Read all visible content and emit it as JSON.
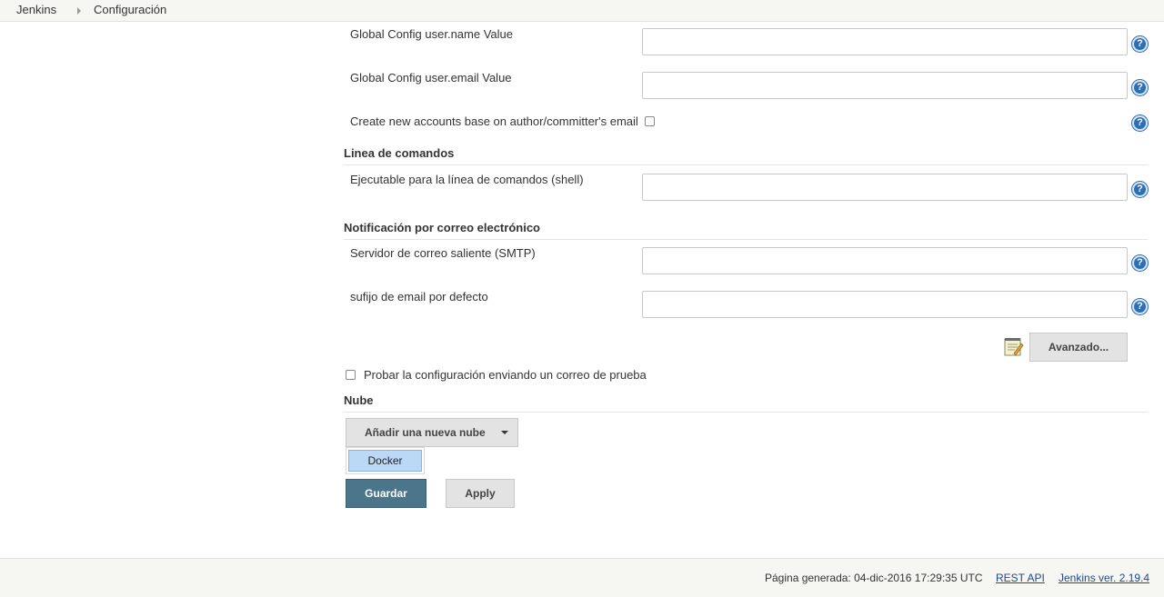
{
  "breadcrumb": {
    "home": "Jenkins",
    "current": "Configuración"
  },
  "git": {
    "user_name_label": "Global Config user.name Value",
    "user_name_value": "",
    "user_email_label": "Global Config user.email Value",
    "user_email_value": "",
    "create_accounts_label": "Create new accounts base on author/committer's email"
  },
  "shell": {
    "section_title": "Linea de comandos",
    "exec_label": "Ejecutable para la línea de comandos (shell)",
    "exec_value": ""
  },
  "email": {
    "section_title": "Notificación por correo electrónico",
    "smtp_label": "Servidor de correo saliente (SMTP)",
    "smtp_value": "",
    "suffix_label": "sufijo de email por defecto",
    "suffix_value": "",
    "advanced_button": "Avanzado...",
    "test_label": "Probar la configuración enviando un correo de prueba"
  },
  "cloud": {
    "section_title": "Nube",
    "add_button": "Añadir una nueva nube",
    "menu_items": [
      "Docker"
    ]
  },
  "actions": {
    "save": "Guardar",
    "apply": "Apply"
  },
  "footer": {
    "generated": "Página generada: 04-dic-2016 17:29:35 UTC",
    "rest_api": "REST API",
    "version": "Jenkins ver. 2.19.4"
  },
  "icons": {
    "help": "help-icon",
    "notepad": "notepad-icon",
    "caret": "caret-down-icon"
  },
  "colors": {
    "primary_button": "#4b758b",
    "help_icon": "#2d6fb5",
    "menu_highlight": "#bcd8f7"
  }
}
